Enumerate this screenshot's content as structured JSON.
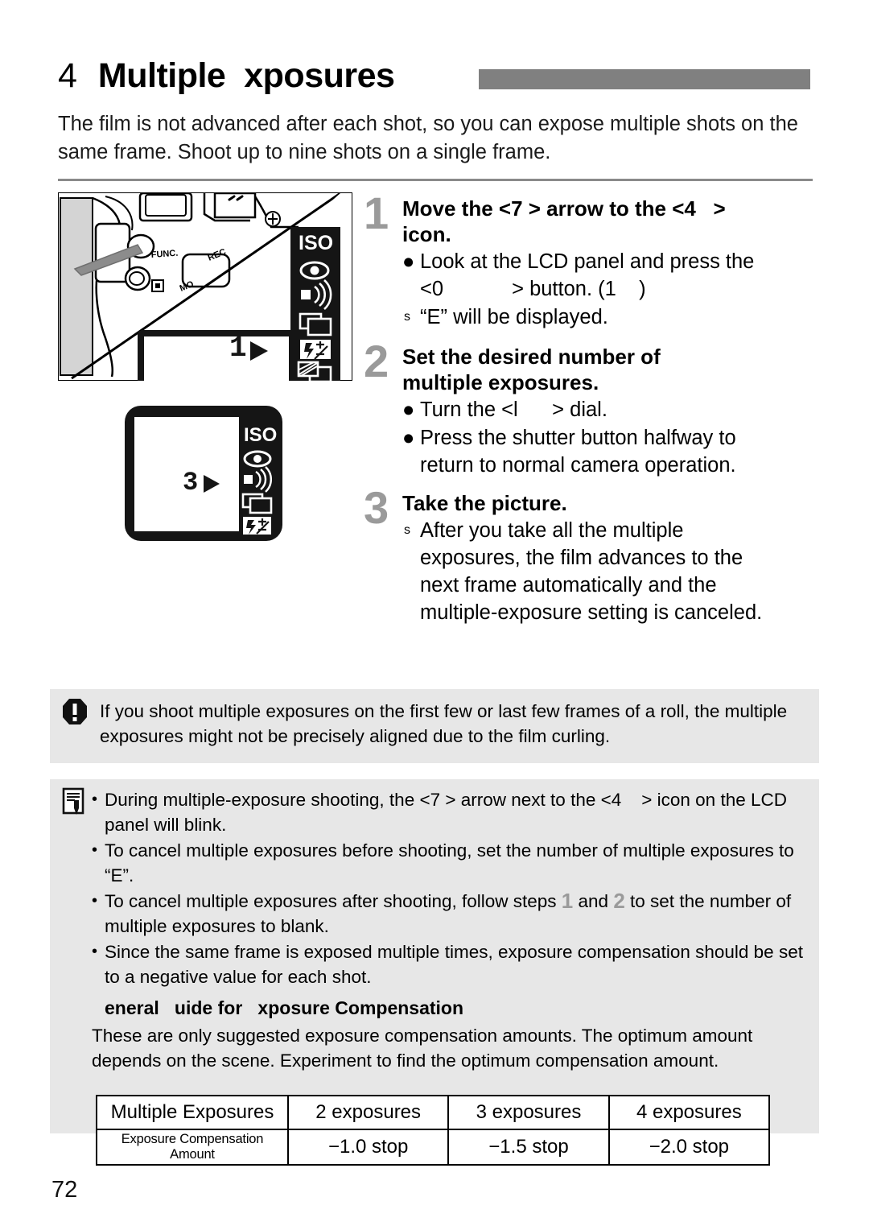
{
  "page": {
    "number": "72"
  },
  "header": {
    "chapter_number": "4",
    "title": "Multiple  xposures",
    "bar_color": "#808080"
  },
  "intro": {
    "text": "The film is not advanced after each shot, so you can expose multiple shots on the same frame. Shoot up to nine shots on a single frame."
  },
  "illustration": {
    "camera_labels": {
      "func": "FUNC.",
      "rec": "REC",
      "mode": "MO"
    },
    "lcd_top": {
      "iso_label": "ISO",
      "digit": "1",
      "icons": [
        "iso-label",
        "red-eye-icon",
        "beep-icon",
        "drive-mode-icon",
        "flash-exposure-compensation-icon",
        "multiple-exposure-icon"
      ]
    },
    "lcd_bottom": {
      "iso_label": "ISO",
      "digit": "3",
      "icons": [
        "iso-label",
        "red-eye-icon",
        "beep-icon",
        "drive-mode-icon",
        "flash-exposure-compensation-icon",
        "multiple-exposure-icon"
      ]
    }
  },
  "steps": [
    {
      "number": "1",
      "heading": "Move the <7 > arrow to the <4   >\nicon.",
      "bullets": [
        {
          "mark": "●",
          "small": false,
          "text": "Look at the LCD panel and press the\n<0            > button. (1    )"
        },
        {
          "mark": "s",
          "small": true,
          "text": "“E” will be displayed."
        }
      ]
    },
    {
      "number": "2",
      "heading": "Set the desired number of\nmultiple exposures.",
      "bullets": [
        {
          "mark": "●",
          "small": false,
          "text": "Turn the <l      > dial."
        },
        {
          "mark": "●",
          "small": false,
          "text": "Press the shutter button halfway to\nreturn to normal camera operation."
        }
      ]
    },
    {
      "number": "3",
      "heading": "Take the picture.",
      "bullets": [
        {
          "mark": "s",
          "small": true,
          "text": "After you take all the multiple\nexposures, the film advances to the\nnext frame automatically and the\nmultiple-exposure setting is canceled."
        }
      ]
    }
  ],
  "warning": {
    "icon": "caution-icon",
    "text": "If you shoot multiple exposures on the first few or last few frames of a roll, the multiple exposures might not be precisely aligned due to the film curling."
  },
  "tips": {
    "icon": "note-pencil-icon",
    "items": [
      {
        "prefix": "During multiple-exposure shooting, the <7 > arrow next to the <4    > icon on the LCD panel will blink.",
        "parts": null
      },
      {
        "prefix": "To cancel multiple exposures before shooting, set the number of multiple exposures to “E”.",
        "parts": null
      },
      {
        "prefix": "To cancel multiple exposures after shooting, follow steps ",
        "ref1": "1",
        "mid": " and ",
        "ref2": "2",
        "suffix": " to set the number of multiple exposures to blank."
      },
      {
        "prefix": "Since the same frame is exposed multiple times, exposure compensation should be set to a negative value for each shot.",
        "parts": null
      }
    ],
    "guide_heading": "eneral   uide for   xposure Compensation",
    "guide_body": "These are only suggested exposure compensation amounts. The optimum amount depends on the scene. Experiment to find the optimum compensation amount."
  },
  "table": {
    "rows": [
      {
        "label": "Multiple Exposures",
        "cells": [
          "2 exposures",
          "3 exposures",
          "4 exposures"
        ]
      },
      {
        "label": "Exposure Compensation Amount",
        "cells": [
          "−1.0 stop",
          "−1.5 stop",
          "−2.0 stop"
        ]
      }
    ]
  }
}
